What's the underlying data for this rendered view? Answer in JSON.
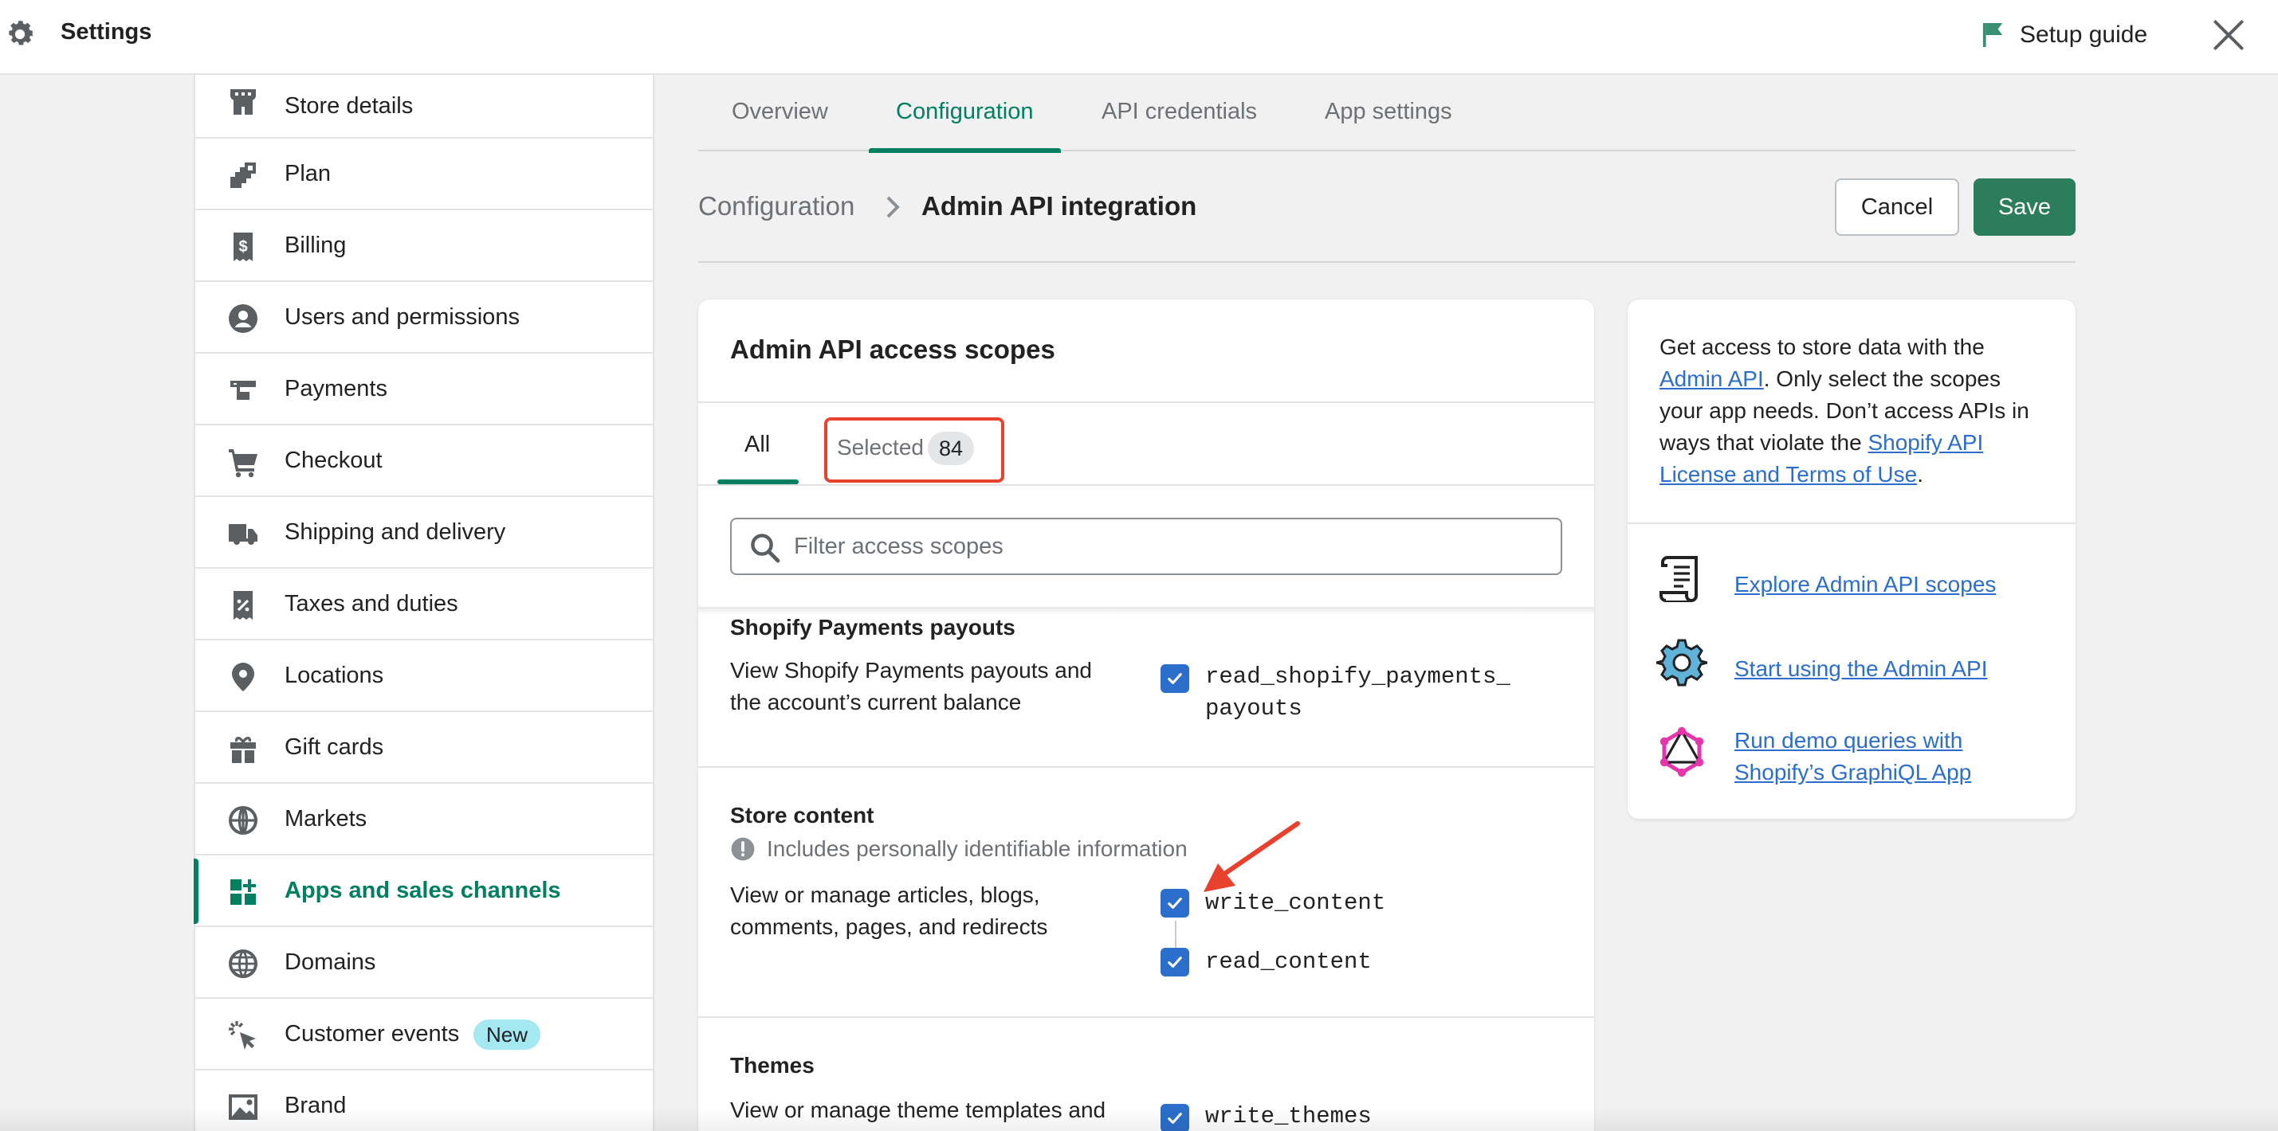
{
  "topbar": {
    "title": "Settings",
    "setup_guide": "Setup guide"
  },
  "sidebar": {
    "items": [
      {
        "label": "Store details",
        "icon": "store-icon"
      },
      {
        "label": "Plan",
        "icon": "plan-icon"
      },
      {
        "label": "Billing",
        "icon": "billing-icon"
      },
      {
        "label": "Users and permissions",
        "icon": "user-icon"
      },
      {
        "label": "Payments",
        "icon": "payments-icon"
      },
      {
        "label": "Checkout",
        "icon": "cart-icon"
      },
      {
        "label": "Shipping and delivery",
        "icon": "truck-icon"
      },
      {
        "label": "Taxes and duties",
        "icon": "taxes-icon"
      },
      {
        "label": "Locations",
        "icon": "location-pin-icon"
      },
      {
        "label": "Gift cards",
        "icon": "gift-icon"
      },
      {
        "label": "Markets",
        "icon": "globe-compass-icon"
      },
      {
        "label": "Apps and sales channels",
        "icon": "apps-icon",
        "active": true
      },
      {
        "label": "Domains",
        "icon": "globe-icon"
      },
      {
        "label": "Customer events",
        "icon": "cursor-click-icon",
        "badge": "New"
      },
      {
        "label": "Brand",
        "icon": "image-icon"
      }
    ]
  },
  "tabs": [
    {
      "label": "Overview"
    },
    {
      "label": "Configuration",
      "active": true
    },
    {
      "label": "API credentials"
    },
    {
      "label": "App settings"
    }
  ],
  "header": {
    "breadcrumb": "Configuration",
    "title": "Admin API integration",
    "cancel": "Cancel",
    "save": "Save"
  },
  "scopes_card": {
    "title": "Admin API access scopes",
    "tab_all": "All",
    "tab_selected": "Selected",
    "selected_count": "84",
    "search_placeholder": "Filter access scopes",
    "sections": [
      {
        "title": "Shopify Payments payouts",
        "description": "View Shopify Payments payouts and the account’s current balance",
        "scopes": [
          {
            "name": "read_shopify_payments_",
            "name_cont": "payouts",
            "checked": true
          }
        ]
      },
      {
        "title": "Store content",
        "pii": "Includes personally identifiable information",
        "description": "View or manage articles, blogs, comments, pages, and redirects",
        "scopes": [
          {
            "name": "write_content",
            "checked": true
          },
          {
            "name": "read_content",
            "checked": true
          }
        ]
      },
      {
        "title": "Themes",
        "description": "View or manage theme templates and",
        "scopes": [
          {
            "name": "write_themes",
            "checked": true
          }
        ]
      }
    ]
  },
  "info_card": {
    "text_1": "Get access to store data with the ",
    "link_admin_api": "Admin API",
    "text_2": ". Only select the scopes your app needs. Don’t access APIs in ways that violate the ",
    "link_terms": "Shopify API License and Terms of Use",
    "text_3": ".",
    "links": [
      {
        "label": "Explore Admin API scopes",
        "icon": "scroll-document-icon"
      },
      {
        "label": "Start using the Admin API",
        "icon": "gear-pixel-icon"
      },
      {
        "label": "Run demo queries with Shopify’s GraphiQL App",
        "icon": "graphql-icon"
      }
    ]
  },
  "colors": {
    "accent": "#008060",
    "save": "#2c7d5b",
    "link": "#2c6ecb",
    "checkbox": "#2c6ecb",
    "annotation": "#e8422f"
  }
}
